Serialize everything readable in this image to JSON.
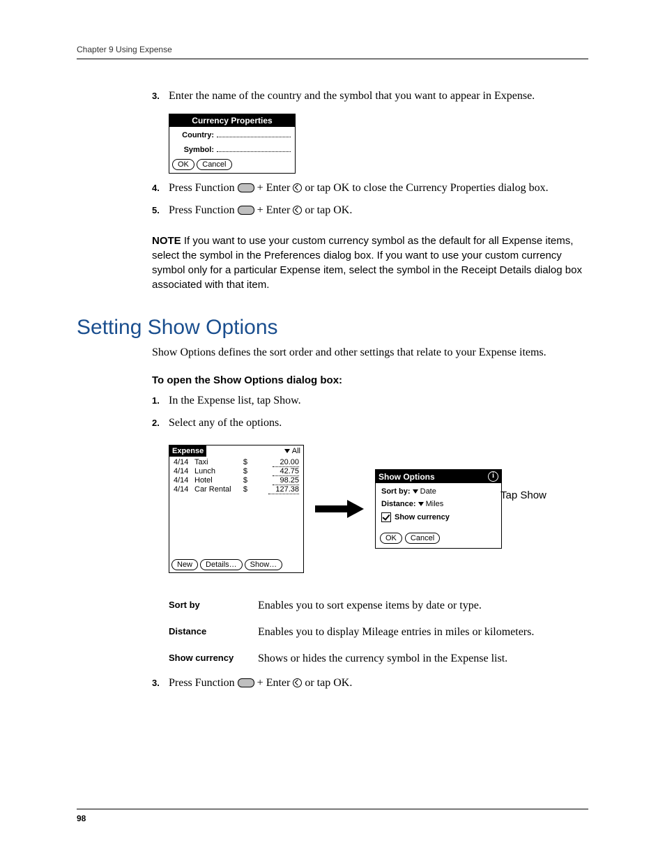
{
  "header": {
    "running_head": "Chapter 9   Using Expense"
  },
  "steps_top": [
    {
      "num": "3.",
      "text": "Enter the name of the country and the symbol that you want to appear in Expense."
    }
  ],
  "currency_dialog": {
    "title": "Currency Properties",
    "rows": [
      {
        "label": "Country:"
      },
      {
        "label": "Symbol:"
      }
    ],
    "ok": "OK",
    "cancel": "Cancel"
  },
  "steps_after_dialog": [
    {
      "num": "4.",
      "pre": "Press Function ",
      "mid": " + Enter ",
      "post": " or tap OK to close the Currency Properties dialog box."
    },
    {
      "num": "5.",
      "pre": "Press Function ",
      "mid": " + Enter ",
      "post": " or tap OK."
    }
  ],
  "note": {
    "lead": "NOTE",
    "text": "   If you want to use your custom currency symbol as the default for all Expense items, select the symbol in the Preferences dialog box. If you want to use your custom currency symbol only for a particular Expense item, select the symbol in the Receipt Details dialog box associated with that item."
  },
  "section_title": "Setting Show Options",
  "section_lead": "Show Options defines the sort order and other settings that relate to your Expense items.",
  "subhead": "To open the Show Options dialog box:",
  "steps_open": [
    {
      "num": "1.",
      "text": "In the Expense list, tap Show."
    },
    {
      "num": "2.",
      "text": "Select any of the options."
    }
  ],
  "expense_screen": {
    "app_name": "Expense",
    "category": "All",
    "rows": [
      {
        "date": "4/14",
        "what": "Taxi",
        "cur": "$",
        "amt": "20.00"
      },
      {
        "date": "4/14",
        "what": "Lunch",
        "cur": "$",
        "amt": "42.75"
      },
      {
        "date": "4/14",
        "what": "Hotel",
        "cur": "$",
        "amt": "98.25"
      },
      {
        "date": "4/14",
        "what": "Car Rental",
        "cur": "$",
        "amt": "127.38"
      }
    ],
    "buttons": {
      "new": "New",
      "details": "Details…",
      "show": "Show…"
    }
  },
  "tap_label": "Tap Show",
  "show_options": {
    "title": "Show Options",
    "sort_by_label": "Sort by:",
    "sort_by_value": "Date",
    "distance_label": "Distance:",
    "distance_value": "Miles",
    "show_currency": "Show currency",
    "ok": "OK",
    "cancel": "Cancel"
  },
  "definitions": [
    {
      "term": "Sort by",
      "desc": "Enables you to sort expense items by date or type."
    },
    {
      "term": "Distance",
      "desc": "Enables you to display Mileage entries in miles or kilometers."
    },
    {
      "term": "Show currency",
      "desc": "Shows or hides the currency symbol in the Expense list."
    }
  ],
  "step_final": {
    "num": "3.",
    "pre": "Press Function ",
    "mid": " + Enter ",
    "post": " or tap OK."
  },
  "page_number": "98"
}
